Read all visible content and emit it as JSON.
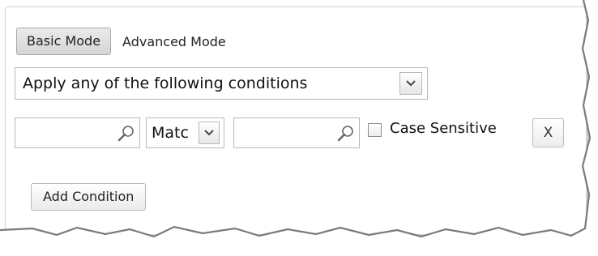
{
  "mode_tabs": {
    "basic_label": "Basic Mode",
    "advanced_label": "Advanced Mode",
    "active": "Basic Mode"
  },
  "match_type": {
    "selected": "Apply any of the following conditions"
  },
  "condition": {
    "left_field_value": "",
    "operator_selected": "Matc",
    "right_field_value": "",
    "case_sensitive_label": "Case Sensitive",
    "case_sensitive_checked": false,
    "remove_label": "X"
  },
  "actions": {
    "add_condition_label": "Add Condition"
  },
  "icons": {
    "search": "magnifier-icon",
    "dropdown": "chevron-down-icon"
  },
  "colors": {
    "border": "#b9b9b9",
    "active_tab_bg": "#dcdcdc",
    "text": "#222222"
  }
}
